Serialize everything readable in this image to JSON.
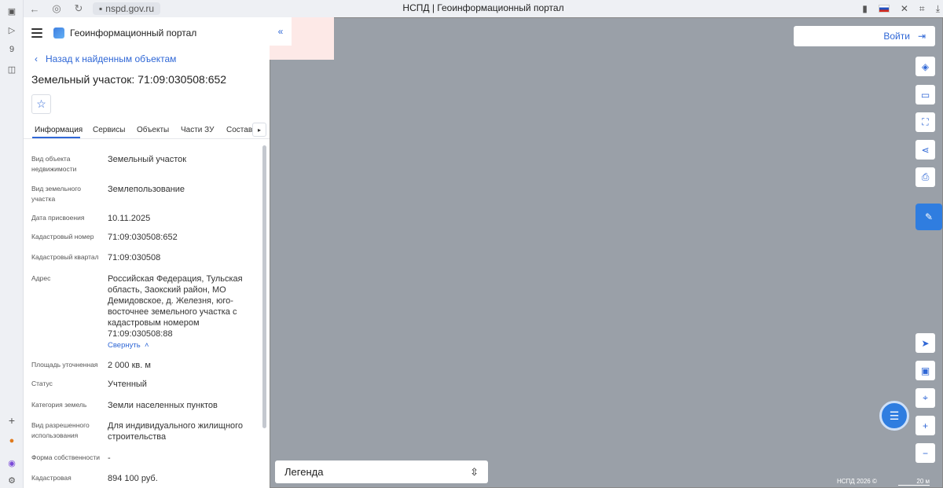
{
  "browser": {
    "url": "nspd.gov.ru",
    "tab_title": "НСПД | Геоинформационный портал",
    "rail_badge": "9"
  },
  "panel": {
    "app_title": "Геоинформационный портал",
    "back_label": "Назад к найденным объектам",
    "title": "Земельный участок: 71:09:030508:652",
    "tabs": [
      "Информация",
      "Сервисы",
      "Объекты",
      "Части ЗУ",
      "Состав"
    ],
    "rows": [
      {
        "label": "Вид объекта недвижимости",
        "value": "Земельный участок"
      },
      {
        "label": "Вид земельного участка",
        "value": "Землепользование"
      },
      {
        "label": "Дата присвоения",
        "value": "10.11.2025"
      },
      {
        "label": "Кадастровый номер",
        "value": "71:09:030508:652"
      },
      {
        "label": "Кадастровый квартал",
        "value": "71:09:030508"
      },
      {
        "label": "Адрес",
        "value": "Российская Федерация, Тульская область, Заокский район, МО Демидовское, д. Железня, юго-восточнее земельного участка с кадастровым номером 71:09:030508:88"
      },
      {
        "label": "Площадь уточненная",
        "value": "2 000 кв. м"
      },
      {
        "label": "Статус",
        "value": "Учтенный"
      },
      {
        "label": "Категория земель",
        "value": "Земли населенных пунктов"
      },
      {
        "label": "Вид разрешенного использования",
        "value": "Для индивидуального жилищного строительства"
      },
      {
        "label": "Форма собственности",
        "value": "-"
      },
      {
        "label": "Кадастровая",
        "value": "894 100 руб."
      }
    ],
    "collapse_label": "Свернуть"
  },
  "map": {
    "login_label": "Войти",
    "legend_label": "Легенда",
    "copyright": "НСПД 2026 ©",
    "scale": "20 м"
  }
}
